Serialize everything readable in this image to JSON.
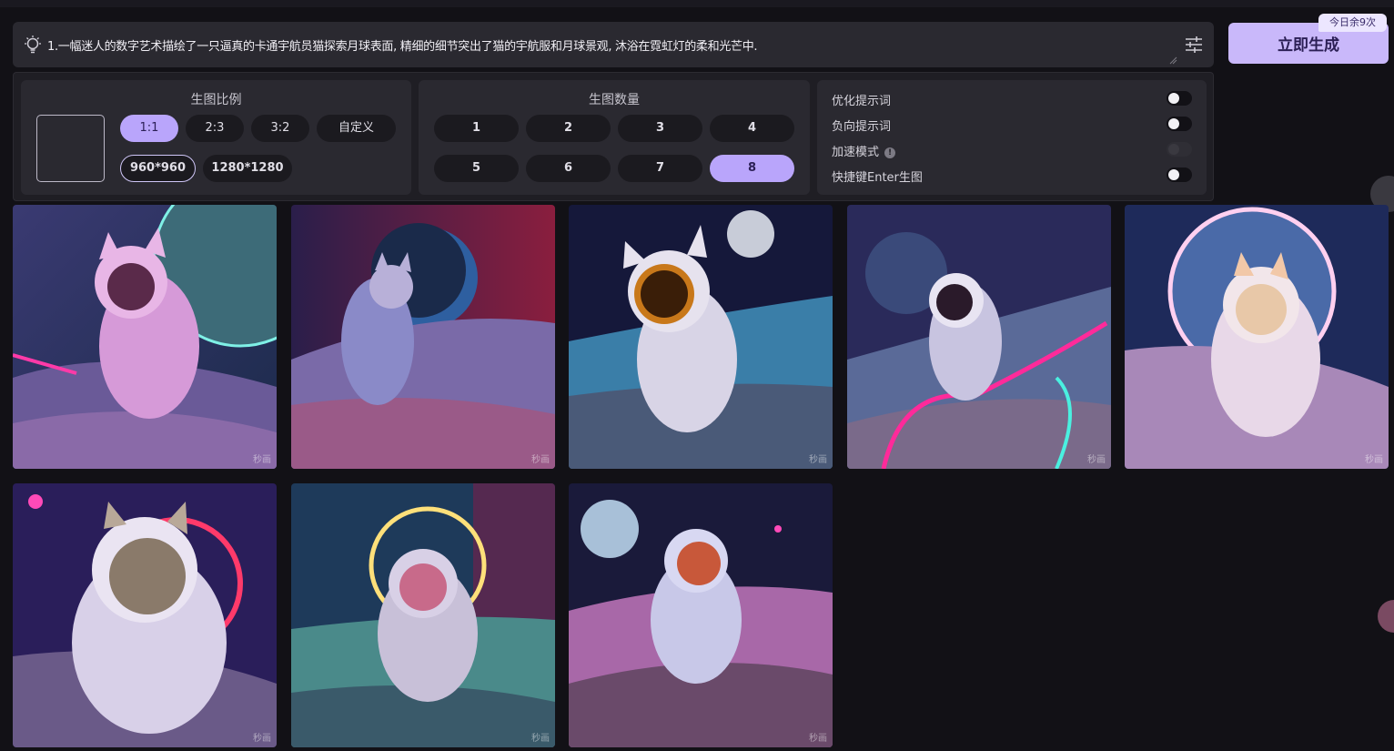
{
  "prompt": {
    "text": "1.一幅迷人的数字艺术描绘了一只逼真的卡通宇航员猫探索月球表面, 精细的细节突出了猫的宇航服和月球景观, 沐浴在霓虹灯的柔和光芒中.",
    "icon": "lightbulb-icon",
    "settings_icon": "sliders-icon"
  },
  "generate": {
    "label": "立即生成",
    "quota": "今日余9次",
    "color": "#c9b8fa"
  },
  "ratio": {
    "title": "生图比例",
    "options": [
      "1:1",
      "2:3",
      "3:2",
      "自定义"
    ],
    "selected": "1:1",
    "sizes": [
      "960*960",
      "1280*1280"
    ],
    "selected_size": "960*960"
  },
  "count": {
    "title": "生图数量",
    "options": [
      "1",
      "2",
      "3",
      "4",
      "5",
      "6",
      "7",
      "8"
    ],
    "selected": "8"
  },
  "toggles": {
    "optimize": "优化提示词",
    "negative": "负向提示词",
    "speed": "加速模式",
    "enter": "快捷键Enter生图"
  },
  "gallery": {
    "watermark": "秒画",
    "count": 8
  },
  "accent": "#b9a5fb"
}
